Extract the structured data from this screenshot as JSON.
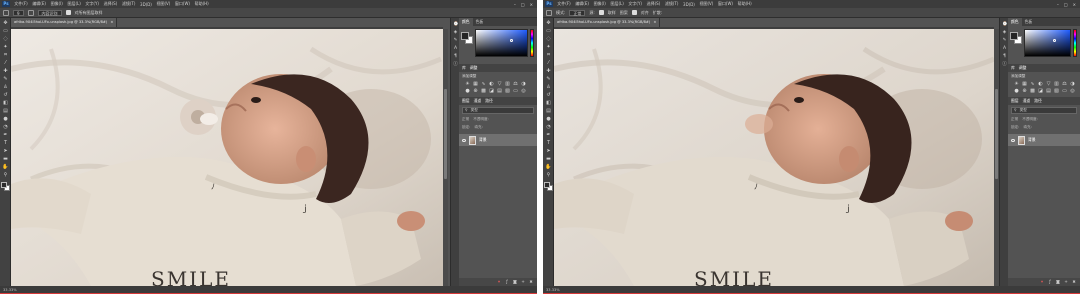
{
  "left": {
    "menu": [
      "文件(F)",
      "编辑(E)",
      "图像(I)",
      "图层(L)",
      "文字(Y)",
      "选择(S)",
      "滤镜(T)",
      "3D(D)",
      "视图(V)",
      "窗口(W)",
      "帮助(H)"
    ],
    "options": {
      "brush_size": "9",
      "mode_label": "内容识别",
      "sample_label": "对所有图层取样"
    },
    "doc_tab": "afrika-9X4l5hoLUFo-unsplash.jpg @ 33.3%(RGB/8#)",
    "status": "33.33%",
    "panels": {
      "color_tabs": [
        "颜色",
        "色板"
      ],
      "adjust_tabs": [
        "库",
        "调整"
      ],
      "adjust_sub": "添加调整",
      "layers_tabs": [
        "图层",
        "通道",
        "路径"
      ],
      "filter_label": "类型",
      "blend_mode": "正常",
      "opacity_label": "不透明度:",
      "lock_label": "锁定:",
      "fill_label": "填充:",
      "layer_name": "背景"
    }
  },
  "right": {
    "menu": [
      "文件(F)",
      "编辑(E)",
      "图像(I)",
      "图层(L)",
      "文字(Y)",
      "选择(S)",
      "滤镜(T)",
      "3D(D)",
      "视图(V)",
      "窗口(W)",
      "帮助(H)"
    ],
    "options": {
      "mode_label": "模式:",
      "mode_value": "正常",
      "source_label": "源:",
      "sample_label": "取样",
      "pattern_label": "图案",
      "aligned_label": "对齐",
      "diffusion_label": "扩散:"
    },
    "doc_tab": "afrika-9X4l5hoLUFo-unsplash.jpg @ 33.3%(RGB/8#)",
    "status": "33.33%",
    "panels": {
      "color_tabs": [
        "颜色",
        "色板"
      ],
      "adjust_tabs": [
        "库",
        "调整"
      ],
      "adjust_sub": "添加调整",
      "layers_tabs": [
        "图层",
        "通道",
        "路径"
      ],
      "filter_label": "类型",
      "blend_mode": "正常",
      "opacity_label": "不透明度:",
      "lock_label": "锁定:",
      "fill_label": "填充:",
      "layer_name": "背景"
    }
  },
  "colors": {
    "app_bg": "#535353",
    "menubar": "#3c3c3c",
    "accent_status": "#d63a3a"
  },
  "icons": [
    "ps-logo",
    "move-icon",
    "marquee-icon",
    "lasso-icon",
    "magic-wand-icon",
    "crop-icon",
    "eyedropper-icon",
    "healing-brush-icon",
    "brush-icon",
    "clone-stamp-icon",
    "history-brush-icon",
    "eraser-icon",
    "gradient-icon",
    "blur-icon",
    "dodge-icon",
    "pen-icon",
    "type-icon",
    "path-select-icon",
    "shape-icon",
    "hand-icon",
    "zoom-icon",
    "eye-icon"
  ]
}
